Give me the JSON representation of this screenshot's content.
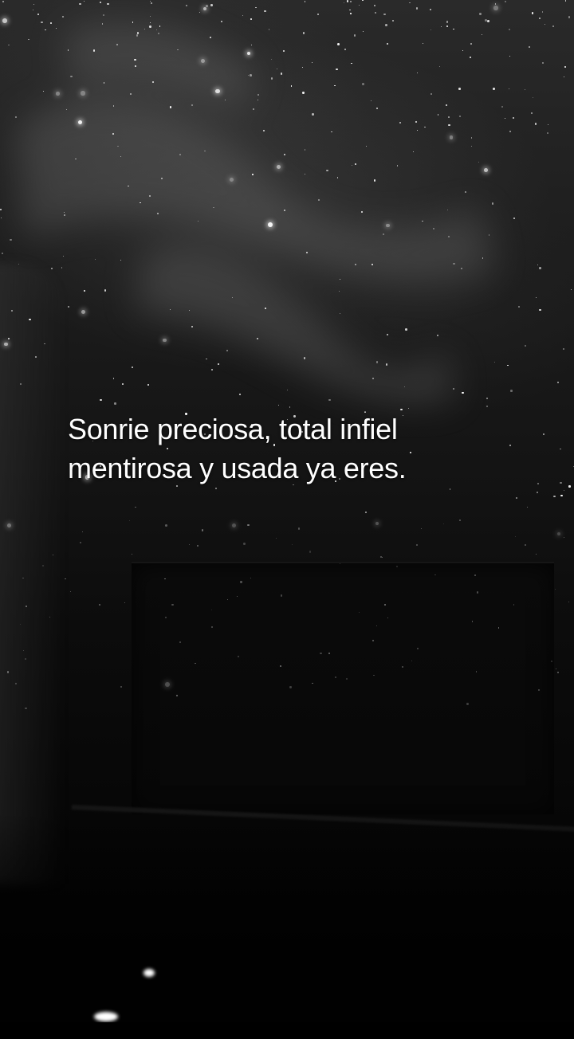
{
  "caption": {
    "line1": "Sonrie preciosa, total infiel",
    "line2": "mentirosa y usada ya eres."
  },
  "colors": {
    "background": "#000000",
    "text": "#ffffff"
  }
}
